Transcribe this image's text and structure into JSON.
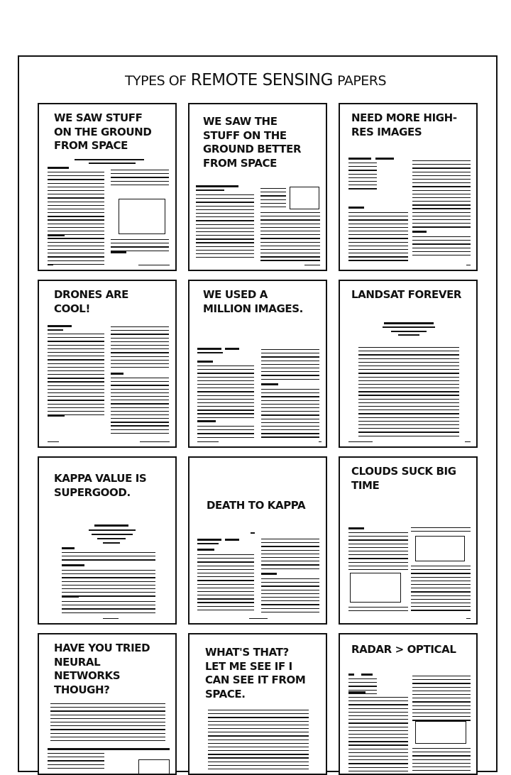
{
  "comic": {
    "title_prefix": "TYPES OF",
    "title_main": "REMOTE SENSING",
    "title_suffix": "PAPERS"
  },
  "panels": [
    {
      "id": "p1",
      "headline": "WE SAW STUFF\nON THE GROUND\nFROM SPACE"
    },
    {
      "id": "p2",
      "headline": "WE SAW THE\nSTUFF ON THE\nGROUND  BETTER\nFROM SPACE"
    },
    {
      "id": "p3",
      "headline": "NEED MORE HIGH-\nRES IMAGES"
    },
    {
      "id": "p4",
      "headline": "DRONES ARE\nCOOL!"
    },
    {
      "id": "p5",
      "headline": "WE USED A\nMILLION IMAGES."
    },
    {
      "id": "p6",
      "headline": "LANDSAT FOREVER"
    },
    {
      "id": "p7",
      "headline": "KAPPA VALUE IS\nSUPERGOOD."
    },
    {
      "id": "p8",
      "headline": "DEATH TO KAPPA"
    },
    {
      "id": "p9",
      "headline": "CLOUDS SUCK BIG\nTIME"
    },
    {
      "id": "p10",
      "headline": "HAVE YOU TRIED\nNEURAL\nNETWORKS\nTHOUGH?"
    },
    {
      "id": "p11",
      "headline": "WHAT'S THAT?\nLET ME SEE IF I\nCAN SEE IT FROM\nSPACE."
    },
    {
      "id": "p12",
      "headline": "RADAR > OPTICAL"
    }
  ]
}
